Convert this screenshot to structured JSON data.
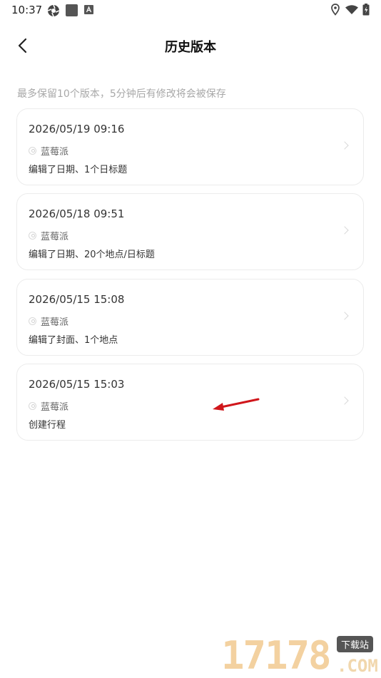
{
  "status_bar": {
    "time": "10:37"
  },
  "header": {
    "title": "历史版本"
  },
  "notice": "最多保留10个版本，5分钟后有修改将会被保存",
  "versions": [
    {
      "datetime": "2026/05/19 09:16",
      "user": "蓝莓派",
      "description": "编辑了日期、1个日标题"
    },
    {
      "datetime": "2026/05/18 09:51",
      "user": "蓝莓派",
      "description": "编辑了日期、20个地点/日标题"
    },
    {
      "datetime": "2026/05/15 15:08",
      "user": "蓝莓派",
      "description": "编辑了封面、1个地点"
    },
    {
      "datetime": "2026/05/15 15:03",
      "user": "蓝莓派",
      "description": "创建行程"
    }
  ],
  "watermark": {
    "digits": "17178",
    "badge": "下载站",
    "suffix": ".COM"
  },
  "colors": {
    "annotation_arrow": "#d0161b",
    "card_border": "#ececec",
    "notice_text": "#a8a8a8"
  }
}
